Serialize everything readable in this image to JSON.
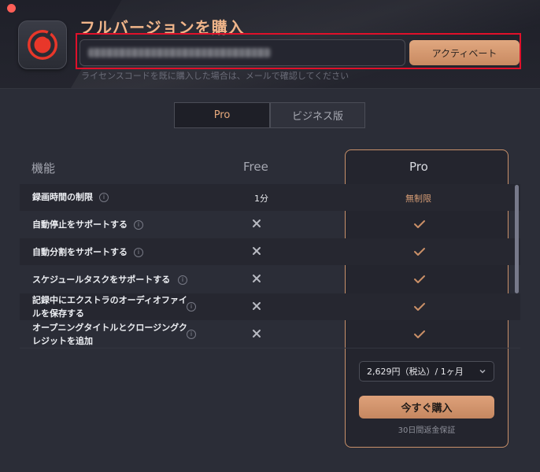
{
  "header": {
    "title": "フルバージョンを購入",
    "license_input_value": "",
    "activate_label": "アクティベート",
    "hint": "ライセンスコードを既に購入した場合は、メールで確認してください"
  },
  "tabs": [
    {
      "label": "Pro",
      "selected": true
    },
    {
      "label": "ビジネス版",
      "selected": false
    }
  ],
  "table": {
    "headers": {
      "feature": "機能",
      "free": "Free",
      "pro": "Pro"
    },
    "rows": [
      {
        "feature": "録画時間の制限",
        "free": "1分",
        "pro": "無制限"
      },
      {
        "feature": "自動停止をサポートする",
        "free": "✕",
        "pro": "✓"
      },
      {
        "feature": "自動分割をサポートする",
        "free": "✕",
        "pro": "✓"
      },
      {
        "feature": "スケジュールタスクをサポートする",
        "free": "✕",
        "pro": "✓"
      },
      {
        "feature": "記録中にエクストラのオーディオファイルを保存する",
        "free": "✕",
        "pro": "✓"
      },
      {
        "feature": "オープニングタイトルとクロージングクレジットを追加",
        "free": "✕",
        "pro": "✓"
      }
    ]
  },
  "plan_select": {
    "value": "2,629円（税込）/ 1ヶ月"
  },
  "buy_label": "今すぐ購入",
  "guarantee": "30日間返金保証",
  "colors": {
    "accent": "#dea17a",
    "highlight_box": "#e0102a",
    "background": "#2b2d37"
  }
}
